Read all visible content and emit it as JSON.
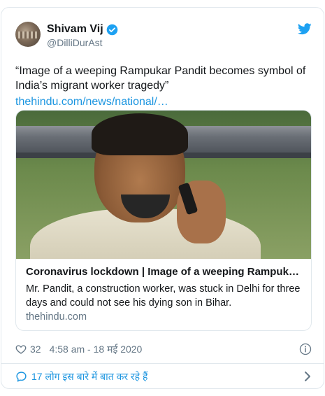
{
  "author": {
    "name": "Shivam Vij",
    "handle": "@DilliDurAst",
    "verified": true
  },
  "tweet": {
    "text": "“Image of a weeping Rampukar Pandit becomes symbol of India’s migrant worker tragedy”",
    "link_text": "thehindu.com/news/national/…"
  },
  "card": {
    "title": "Coronavirus lockdown | Image of a weeping Rampukar P…",
    "description": "Mr. Pandit, a construction worker, was stuck in Delhi for three days and could not see his dying son in Bihar.",
    "domain": "thehindu.com"
  },
  "meta": {
    "like_count": "32",
    "timestamp": "4:58 am - 18 मई 2020"
  },
  "footer": {
    "conversation_text": "17 लोग इस बारे में बात कर रहे हैं"
  },
  "icons": {
    "verified": "verified-badge-icon",
    "bird": "twitter-bird-icon",
    "heart": "heart-icon",
    "info": "info-icon",
    "comment": "comment-icon",
    "chevron": "chevron-right-icon"
  },
  "colors": {
    "accent": "#1b95e0",
    "muted": "#657786",
    "border": "#e1e8ed",
    "text": "#14171a"
  }
}
